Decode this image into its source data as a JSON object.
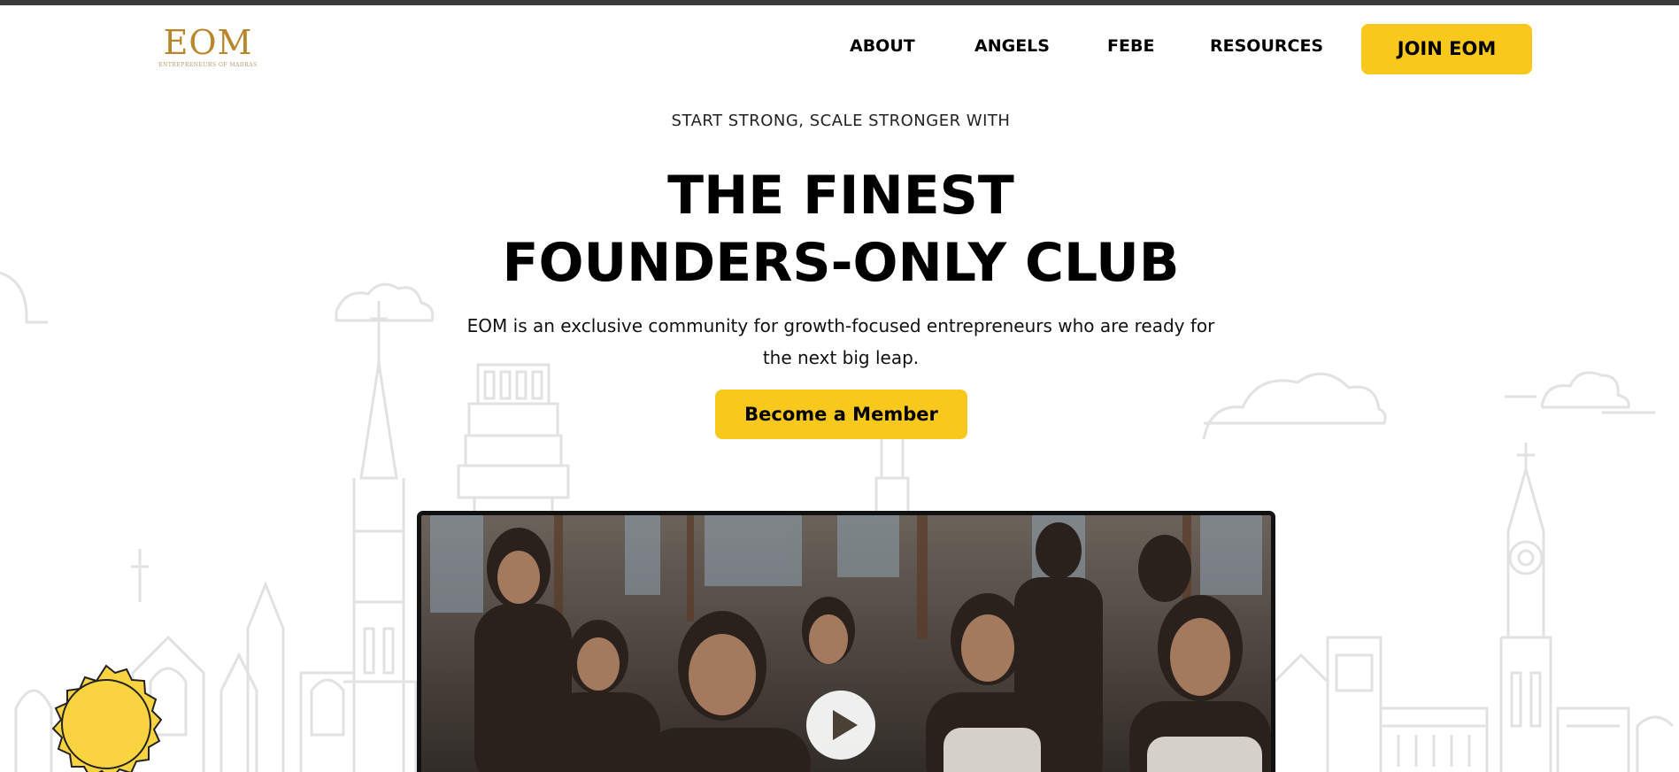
{
  "brand": {
    "logo_text": "EOM",
    "logo_subtitle": "ENTREPRENEURS OF MADRAS",
    "logo_color": "#b8862b"
  },
  "nav": {
    "items": [
      {
        "label": "ABOUT"
      },
      {
        "label": "ANGELS"
      },
      {
        "label": "FEBE"
      },
      {
        "label": "RESOURCES"
      }
    ],
    "cta_label": "JOIN EOM"
  },
  "hero": {
    "eyebrow": "START STRONG, SCALE STRONGER WITH",
    "headline_line1": "THE FINEST",
    "headline_line2": "FOUNDERS-ONLY CLUB",
    "description": "EOM is an exclusive community for growth-focused entrepreneurs who are ready for the next big leap.",
    "cta_label": "Become a Member"
  },
  "video": {
    "icon": "play-icon"
  },
  "colors": {
    "accent": "#f8c81c",
    "text": "#000000",
    "skyline_line": "#e2e2e2",
    "seal_fill": "#fad440"
  }
}
